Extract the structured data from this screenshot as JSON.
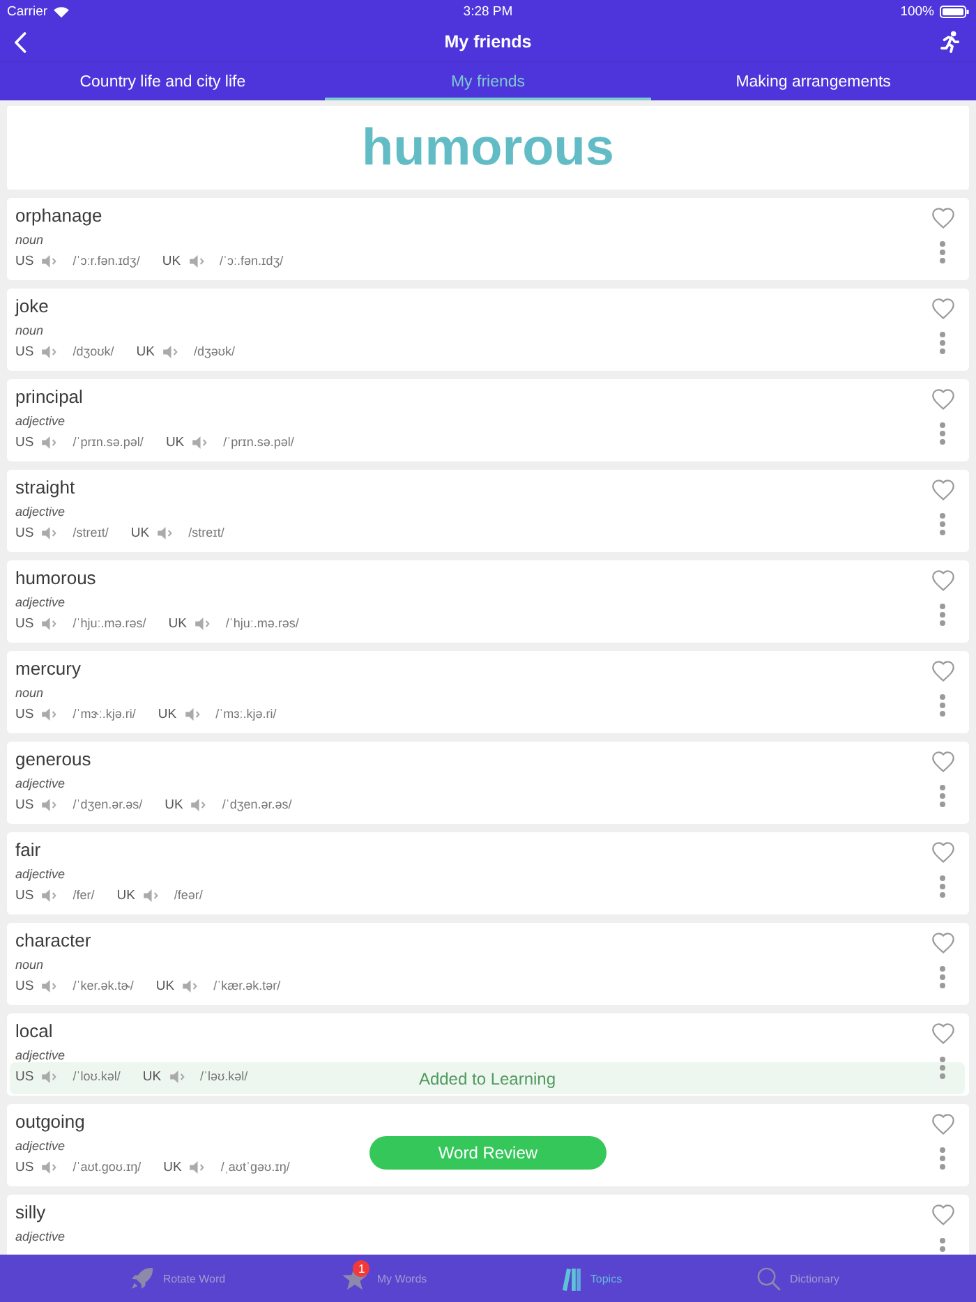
{
  "status_bar": {
    "carrier": "Carrier",
    "time": "3:28 PM",
    "battery": "100%"
  },
  "nav_bar": {
    "title": "My friends"
  },
  "tabs": [
    {
      "label": "Country life and city life",
      "selected": false
    },
    {
      "label": "My friends",
      "selected": true
    },
    {
      "label": "Making arrangements",
      "selected": false
    }
  ],
  "banner": {
    "word": "humorous"
  },
  "words": [
    {
      "word": "orphanage",
      "part_of_speech": "noun",
      "favorite": false,
      "pronunciations": [
        {
          "region": "US",
          "ipa": "/ˈɔːr.fən.ɪdʒ/"
        },
        {
          "region": "UK",
          "ipa": "/ˈɔː.fən.ɪdʒ/"
        }
      ]
    },
    {
      "word": "joke",
      "part_of_speech": "noun",
      "favorite": false,
      "pronunciations": [
        {
          "region": "US",
          "ipa": "/dʒoʊk/"
        },
        {
          "region": "UK",
          "ipa": "/dʒəʊk/"
        }
      ]
    },
    {
      "word": "principal",
      "part_of_speech": "adjective",
      "favorite": false,
      "pronunciations": [
        {
          "region": "US",
          "ipa": "/ˈprɪn.sə.pəl/"
        },
        {
          "region": "UK",
          "ipa": "/ˈprɪn.sə.pəl/"
        }
      ]
    },
    {
      "word": "straight",
      "part_of_speech": "adjective",
      "favorite": false,
      "pronunciations": [
        {
          "region": "US",
          "ipa": "/streɪt/"
        },
        {
          "region": "UK",
          "ipa": "/streɪt/"
        }
      ]
    },
    {
      "word": "humorous",
      "part_of_speech": "adjective",
      "favorite": false,
      "pronunciations": [
        {
          "region": "US",
          "ipa": "/ˈhjuː.mə.rəs/"
        },
        {
          "region": "UK",
          "ipa": "/ˈhjuː.mə.rəs/"
        }
      ]
    },
    {
      "word": "mercury",
      "part_of_speech": "noun",
      "favorite": false,
      "pronunciations": [
        {
          "region": "US",
          "ipa": "/ˈmɝː.kjə.ri/"
        },
        {
          "region": "UK",
          "ipa": "/ˈmɜː.kjə.ri/"
        }
      ]
    },
    {
      "word": "generous",
      "part_of_speech": "adjective",
      "favorite": false,
      "pronunciations": [
        {
          "region": "US",
          "ipa": "/ˈdʒen.ər.əs/"
        },
        {
          "region": "UK",
          "ipa": "/ˈdʒen.ər.əs/"
        }
      ]
    },
    {
      "word": "fair",
      "part_of_speech": "adjective",
      "favorite": false,
      "pronunciations": [
        {
          "region": "US",
          "ipa": "/fer/"
        },
        {
          "region": "UK",
          "ipa": "/feər/"
        }
      ]
    },
    {
      "word": "character",
      "part_of_speech": "noun",
      "favorite": false,
      "pronunciations": [
        {
          "region": "US",
          "ipa": "/ˈker.ək.tɚ/"
        },
        {
          "region": "UK",
          "ipa": "/ˈkær.ək.tər/"
        }
      ]
    },
    {
      "word": "local",
      "part_of_speech": "adjective",
      "favorite": false,
      "pronunciations": [
        {
          "region": "US",
          "ipa": "/ˈloʊ.kəl/"
        },
        {
          "region": "UK",
          "ipa": "/ˈləʊ.kəl/"
        }
      ]
    },
    {
      "word": "outgoing",
      "part_of_speech": "adjective",
      "favorite": false,
      "pronunciations": [
        {
          "region": "US",
          "ipa": "/ˈaʊt.ɡoʊ.ɪŋ/"
        },
        {
          "region": "UK",
          "ipa": "/ˌaʊtˈɡəʊ.ɪŋ/"
        }
      ]
    },
    {
      "word": "silly",
      "part_of_speech": "adjective",
      "favorite": false
    }
  ],
  "toast": {
    "text": "Added to Learning"
  },
  "review_button": {
    "label": "Word Review"
  },
  "tab_bar": [
    {
      "kind": "rocket",
      "label": "Rotate Word",
      "selected": false
    },
    {
      "kind": "star",
      "label": "My Words",
      "selected": false,
      "badge": "1"
    },
    {
      "kind": "books",
      "label": "Topics",
      "selected": true
    },
    {
      "kind": "search",
      "label": "Dictionary",
      "selected": false
    }
  ]
}
